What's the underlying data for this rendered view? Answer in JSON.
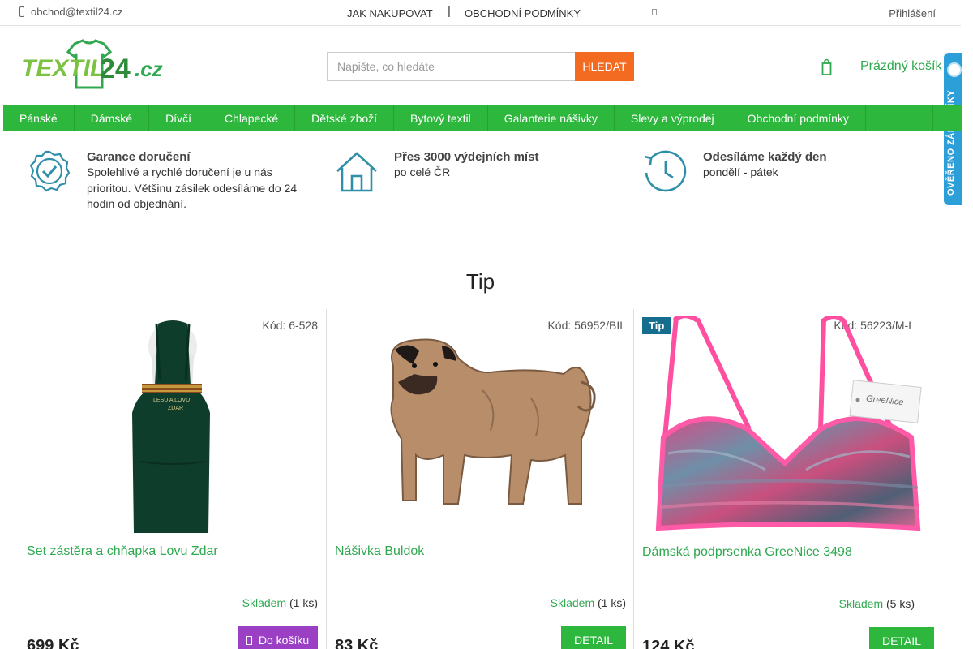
{
  "topbar": {
    "email": "obchod@textil24.cz",
    "links": [
      "JAK NAKUPOVAT",
      "OBCHODNÍ PODMÍNKY"
    ],
    "separator": "|",
    "login": "Přihlášení"
  },
  "header": {
    "logo_text": "TEXTIL24.cz",
    "search_placeholder": "Napište, co hledáte",
    "search_button": "HLEDAT",
    "cart_label": "Prázdný košík"
  },
  "sidebadge": {
    "label": "OVĚŘENO ZÁKAZNÍKY"
  },
  "nav": [
    "Pánské",
    "Dámské",
    "Dívčí",
    "Chlapecké",
    "Dětské zboží",
    "Bytový textil",
    "Galanterie nášivky",
    "Slevy a výprodej",
    "Obchodní podmínky"
  ],
  "benefits": [
    {
      "icon": "badge-check-icon",
      "title": "Garance doručení",
      "text": "Spolehlivé a rychlé doručení je u nás prioritou. Většinu zásilek odesíláme do 24 hodin od objednání."
    },
    {
      "icon": "house-icon",
      "title": "Přes 3000 výdejních míst",
      "text": "po celé ČR"
    },
    {
      "icon": "clock-history-icon",
      "title": "Odesíláme každý den",
      "text": "pondělí - pátek"
    }
  ],
  "section_title": "Tip",
  "products": [
    {
      "code": "Kód: 6-528",
      "name": "Set zástěra a chňapka Lovu Zdar",
      "stock_label": "Skladem",
      "stock_count": "(1 ks)",
      "price": "699 Kč",
      "button": "Do košíku",
      "apron_text_1": "LESU A LOVU",
      "apron_text_2": "ZDAR"
    },
    {
      "code": "Kód: 56952/BIL",
      "name": "Nášivka Buldok",
      "stock_label": "Skladem",
      "stock_count": "(1 ks)",
      "price": "83 Kč",
      "button": "DETAIL"
    },
    {
      "code": "Kód: 56223/M-L",
      "flag": "Tip",
      "name": "Dámská podprsenka GreeNice 3498",
      "stock_label": "Skladem",
      "stock_count": "(5 ks)",
      "price": "124 Kč",
      "button": "DETAIL",
      "tag_text": "GreeNice"
    }
  ],
  "colors": {
    "green": "#2db83d",
    "orange": "#f26b21",
    "purple": "#9b3fc5",
    "teal": "#156e8e",
    "badge_blue": "#2d9fd8"
  }
}
